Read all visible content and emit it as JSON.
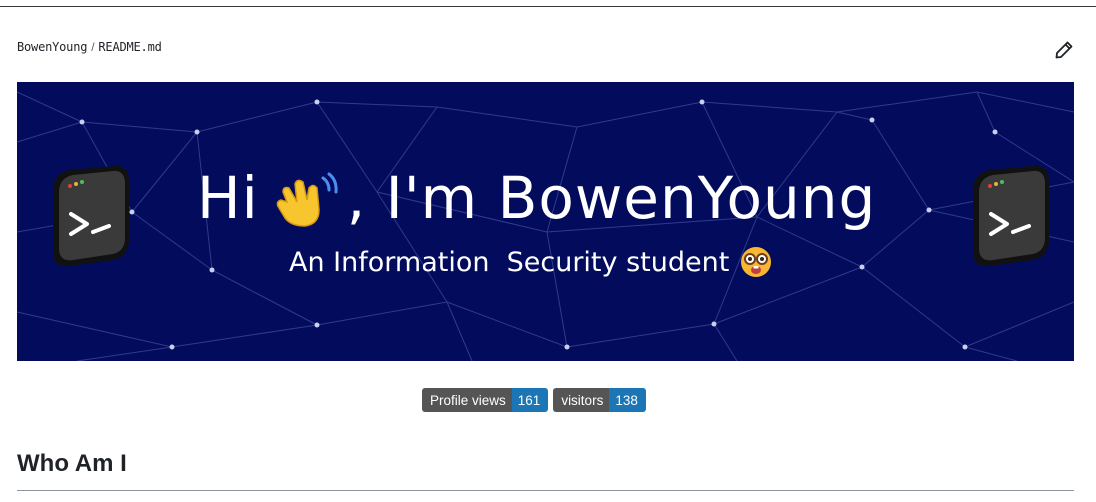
{
  "breadcrumb": {
    "owner": "BowenYoung",
    "separator": "/",
    "file": "README.md"
  },
  "banner": {
    "greeting_hi": "Hi",
    "greeting_name": ", I'm BowenYoung",
    "subtitle": "An Information  Security student",
    "background_color": "#030c5c"
  },
  "badges": [
    {
      "label": "Profile views",
      "value": "161",
      "label_color": "#555555",
      "value_color": "#1c75b4"
    },
    {
      "label": "visitors",
      "value": "138",
      "label_color": "#555555",
      "value_color": "#1c75b4"
    }
  ],
  "section": {
    "heading": "Who Am I"
  },
  "icons": {
    "edit": "pencil-icon",
    "wave": "waving-hand-icon",
    "nerd": "nerd-face-icon",
    "terminal": "terminal-icon"
  }
}
